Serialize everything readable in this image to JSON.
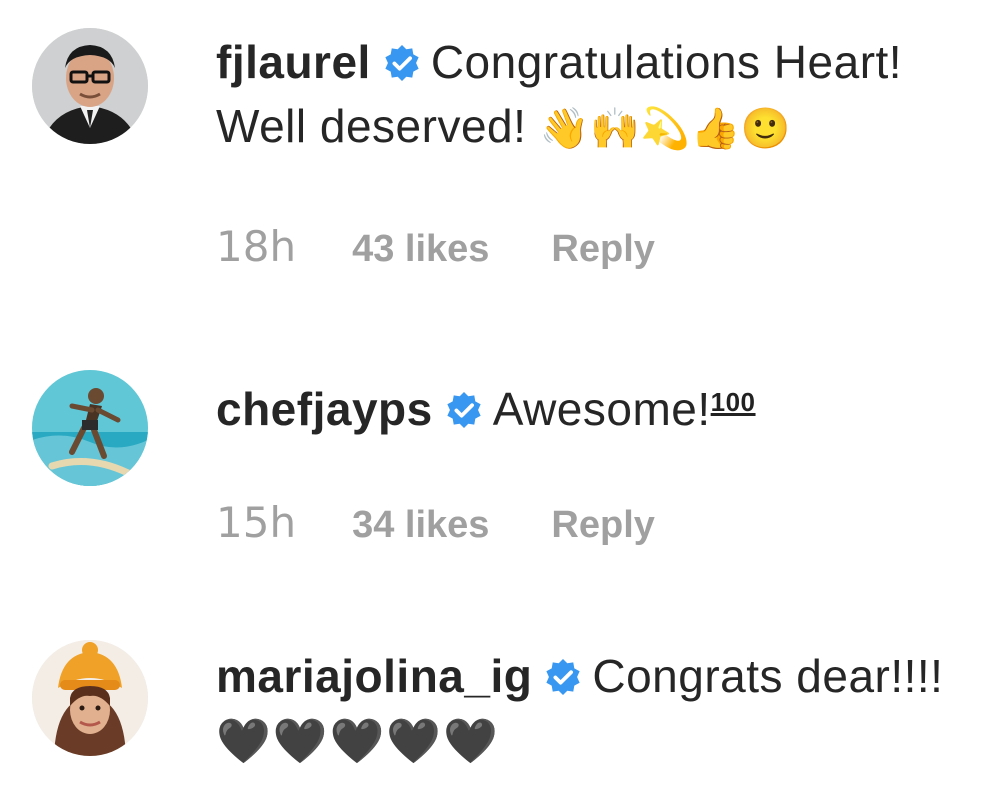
{
  "comments": [
    {
      "username": "fjlaurel",
      "verified": true,
      "text": "Congratulations Heart! Well deserved!",
      "emoji": "👋🙌💫👍🙂",
      "time": "18h",
      "likes": "43 likes",
      "reply": "Reply",
      "avatar_icon": "avatar-man-glasses"
    },
    {
      "username": "chefjayps",
      "verified": true,
      "text": "Awesome!",
      "emoji": "100",
      "time": "15h",
      "likes": "34 likes",
      "reply": "Reply",
      "avatar_icon": "avatar-surfer-beach"
    },
    {
      "username": "mariajolina_ig",
      "verified": true,
      "text": "Congrats dear!!!!",
      "emoji": "🖤🖤🖤🖤🖤",
      "avatar_icon": "avatar-woman-orange-hat"
    }
  ],
  "colors": {
    "verified_blue": "#3897f0",
    "meta_gray": "#a0a0a0",
    "text": "#262626"
  }
}
